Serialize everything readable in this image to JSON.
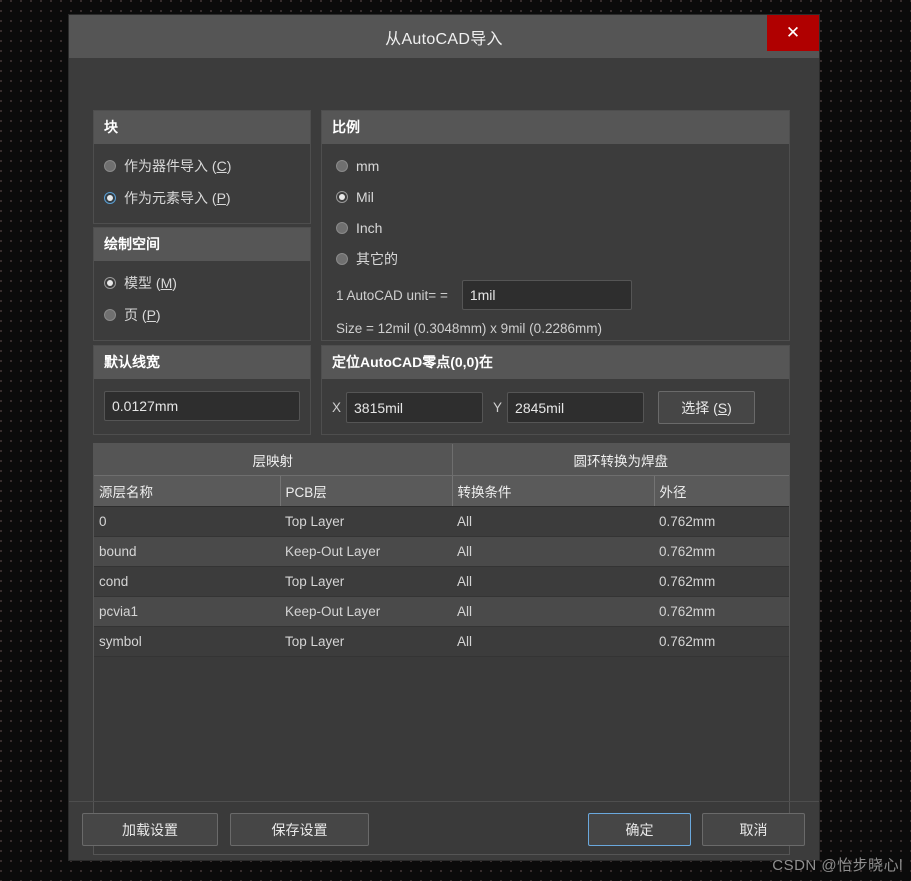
{
  "window": {
    "title": "从AutoCAD导入",
    "close_label": "✕"
  },
  "block_panel": {
    "header": "块",
    "options": [
      {
        "label": "作为器件导入 (C)",
        "text": "作为器件导入 (",
        "key": "C",
        "checked": false
      },
      {
        "label": "作为元素导入 (P)",
        "text": "作为元素导入 (",
        "key": "P",
        "checked": true
      }
    ]
  },
  "space_panel": {
    "header": "绘制空间",
    "options": [
      {
        "text": "模型 (",
        "key": "M",
        "checked": true
      },
      {
        "text": "页 (",
        "key": "P",
        "checked": false
      }
    ]
  },
  "scale_panel": {
    "header": "比例",
    "options": [
      {
        "text": "mm",
        "key": "",
        "checked": false
      },
      {
        "text": "Mil",
        "key": "",
        "checked": true
      },
      {
        "text": "Inch",
        "key": "",
        "checked": false
      },
      {
        "text": "其它的",
        "key": "",
        "checked": false
      }
    ],
    "unit_label": "1 AutoCAD unit= =",
    "unit_value": "1mil",
    "size_text": "Size = 12mil (0.3048mm) x 9mil (0.2286mm)"
  },
  "linewidth_panel": {
    "header": "默认线宽",
    "value": "0.0127mm"
  },
  "origin_panel": {
    "header": "定位AutoCAD零点(0,0)在",
    "x_label": "X",
    "x_value": "3815mil",
    "y_label": "Y",
    "y_value": "2845mil",
    "select_text": "选择 (",
    "select_key": "S"
  },
  "table": {
    "group_headers": [
      "层映射",
      "圆环转换为焊盘"
    ],
    "columns": [
      "源层名称",
      "PCB层",
      "转换条件",
      "外径"
    ],
    "rows": [
      {
        "source": "0",
        "pcb": "Top Layer",
        "cond": "All",
        "diameter": "0.762mm"
      },
      {
        "source": "bound",
        "pcb": "Keep-Out Layer",
        "cond": "All",
        "diameter": "0.762mm"
      },
      {
        "source": "cond",
        "pcb": "Top Layer",
        "cond": "All",
        "diameter": "0.762mm"
      },
      {
        "source": "pcvia1",
        "pcb": "Keep-Out Layer",
        "cond": "All",
        "diameter": "0.762mm"
      },
      {
        "source": "symbol",
        "pcb": "Top Layer",
        "cond": "All",
        "diameter": "0.762mm"
      }
    ]
  },
  "footer": {
    "load_settings": "加载设置",
    "save_settings": "保存设置",
    "ok": "确定",
    "cancel": "取消"
  },
  "watermark": "CSDN @怡步晓心l",
  "colors": {
    "dialog_bg": "#3c3c3c",
    "titlebar_bg": "#555555",
    "close_red": "#b00000",
    "accent_blue": "#6aa8dd",
    "panel_header_bg": "#565656",
    "input_bg": "#2e2e2e"
  }
}
